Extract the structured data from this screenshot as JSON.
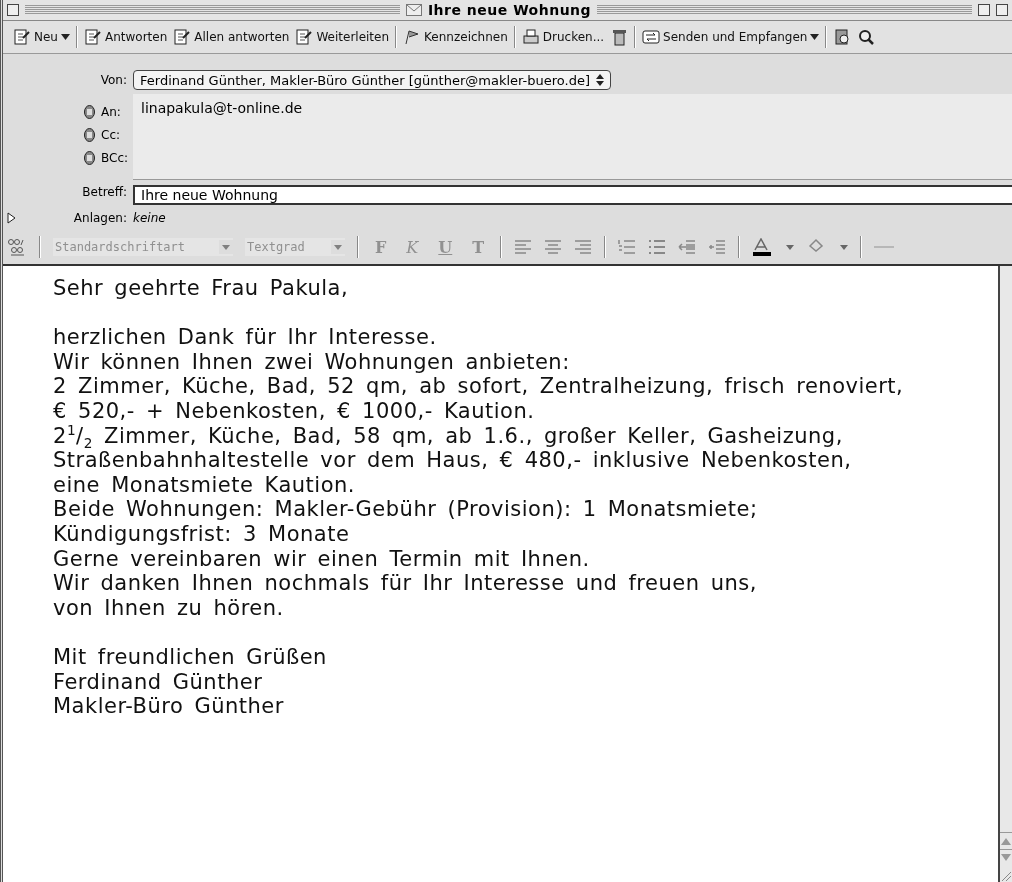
{
  "window": {
    "title": "Ihre neue Wohnung"
  },
  "toolbar": [
    {
      "kind": "new",
      "label": "Neu",
      "dropdown": true
    },
    {
      "kind": "separator"
    },
    {
      "kind": "reply",
      "label": "Antworten",
      "dropdown": false
    },
    {
      "kind": "reply",
      "label": "Allen antworten",
      "dropdown": false
    },
    {
      "kind": "forward",
      "label": "Weiterleiten",
      "dropdown": false
    },
    {
      "kind": "separator"
    },
    {
      "kind": "flag",
      "label": "Kennzeichnen",
      "dropdown": false
    },
    {
      "kind": "separator"
    },
    {
      "kind": "print",
      "label": "Drucken...",
      "dropdown": false
    },
    {
      "kind": "trash",
      "dropdown": false
    },
    {
      "kind": "separator"
    },
    {
      "kind": "send",
      "label": "Senden und Empfangen",
      "dropdown": true
    },
    {
      "kind": "separator"
    },
    {
      "kind": "book",
      "dropdown": false
    },
    {
      "kind": "find",
      "dropdown": false
    }
  ],
  "header": {
    "from_label": "Von:",
    "from_value": "Ferdinand Günther, Makler-Büro Günther [günther@makler-buero.de]",
    "recipients": [
      {
        "label": "An:",
        "value": "linapakula@t-online.de"
      },
      {
        "label": "Cc:"
      },
      {
        "label": "BCc:"
      }
    ],
    "subject_label": "Betreff:",
    "subject_value": "Ihre neue Wohnung",
    "attachments_label": "Anlagen:",
    "attachments_value": "keine"
  },
  "format_bar": {
    "font": "Standardschriftart",
    "size": "Textgrad",
    "style_buttons": [
      {
        "label": "F",
        "kind": "bold"
      },
      {
        "label": "K",
        "kind": "italic"
      },
      {
        "label": "U",
        "kind": "underline"
      },
      {
        "label": "T",
        "kind": "mono"
      }
    ],
    "disabled": true
  },
  "body": {
    "paragraphs": [
      [
        "Sehr geehrte Frau Pakula,"
      ],
      [
        "herzlichen Dank für Ihr Interesse.",
        "Wir können Ihnen zwei Wohnungen anbieten:",
        "2 Zimmer, Küche, Bad, 52 qm, ab sofort, Zentralheizung, frisch renoviert,",
        "€ 520,- + Nebenkosten, € 1000,- Kaution.",
        "2$^{1}$/$_{2}$ Zimmer, Küche, Bad, 58 qm, ab 1.6., großer Keller, Gasheizung,",
        "Straßenbahnhaltestelle vor dem Haus, € 480,- inklusive Nebenkosten,",
        "eine Monatsmiete Kaution.",
        "Beide Wohnungen: Makler-Gebühr (Provision): 1 Monatsmiete;",
        "Kündigungsfrist: 3 Monate",
        "Gerne vereinbaren wir einen Termin mit Ihnen.",
        "Wir danken Ihnen nochmals für Ihr Interesse und freuen uns,",
        "von Ihnen zu hören."
      ],
      [
        "Mit freundlichen Grüßen",
        "Ferdinand Günther",
        "Makler-Büro Günther"
      ]
    ]
  }
}
